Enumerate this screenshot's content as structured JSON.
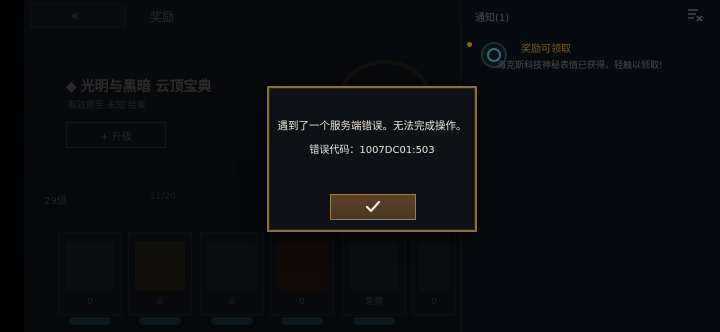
{
  "background": {
    "page_title": "奖励",
    "event_title": "光明与黑暗 云顶宝典",
    "event_subtitle": "有效期至 未知 结束",
    "event_button_label": "+ 升级",
    "tabs": [
      "29级",
      "11/20"
    ],
    "cards": [
      {
        "count": "0",
        "style": "plain"
      },
      {
        "count": "0",
        "style": "gold"
      },
      {
        "count": "0",
        "style": "plain"
      },
      {
        "count": "0",
        "style": "orange"
      },
      {
        "count": "免费",
        "style": "plain"
      },
      {
        "count": "0",
        "style": "plain"
      }
    ]
  },
  "notifications": {
    "title": "通知(1)",
    "items": [
      {
        "title": "奖励可领取",
        "body": "海克斯科技神秘表情已获得。轻触以领取!"
      }
    ]
  },
  "modal": {
    "message": "遇到了一个服务端错误。无法完成操作。",
    "error_code": "错误代码：1007DC01:503",
    "confirm_icon": "check-icon"
  },
  "colors": {
    "modal_border": "#8a6f3a",
    "button_fill": "#5a4428",
    "notif_accent": "#b08c46"
  }
}
